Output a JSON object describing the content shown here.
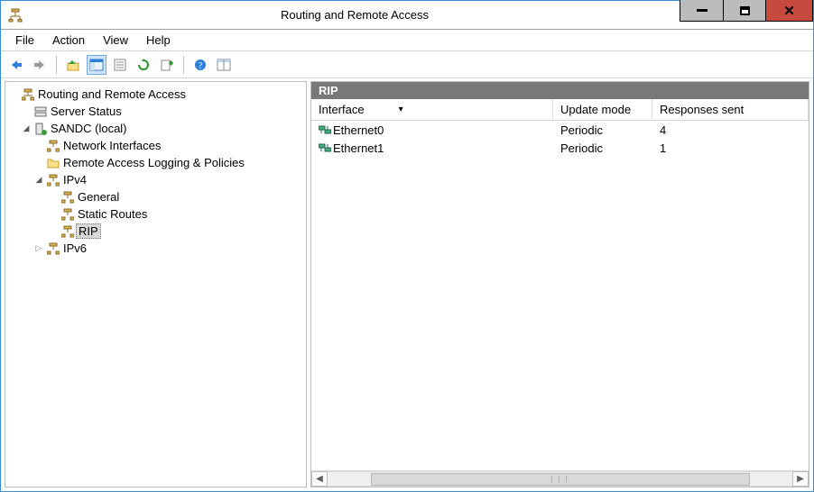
{
  "window": {
    "title": "Routing and Remote Access"
  },
  "menu": {
    "file": "File",
    "action": "Action",
    "view": "View",
    "help": "Help"
  },
  "tree": {
    "root": "Routing and Remote Access",
    "server_status": "Server Status",
    "server": "SANDC (local)",
    "network_interfaces": "Network Interfaces",
    "remote_access_logging": "Remote Access Logging & Policies",
    "ipv4": "IPv4",
    "general": "General",
    "static_routes": "Static Routes",
    "rip": "RIP",
    "ipv6": "IPv6"
  },
  "panel": {
    "title": "RIP"
  },
  "columns": {
    "interface": "Interface",
    "update_mode": "Update mode",
    "responses_sent": "Responses sent"
  },
  "rows": [
    {
      "interface": "Ethernet0",
      "update_mode": "Periodic",
      "responses_sent": "4"
    },
    {
      "interface": "Ethernet1",
      "update_mode": "Periodic",
      "responses_sent": "1"
    }
  ]
}
